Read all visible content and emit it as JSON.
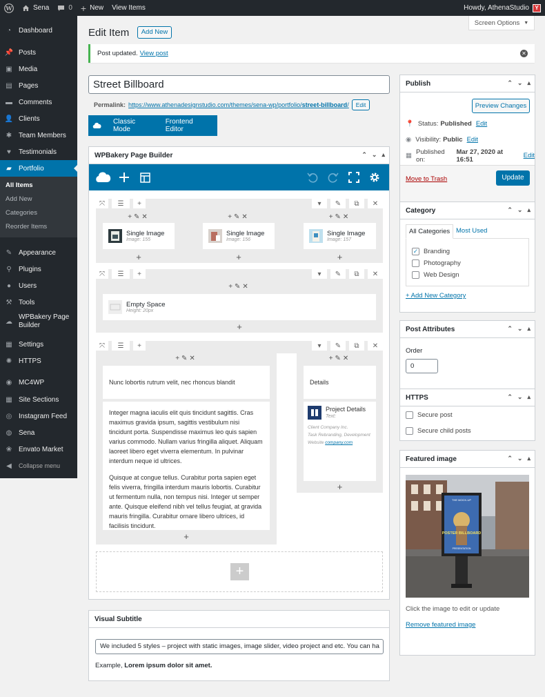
{
  "admin_bar": {
    "site_name": "Sena",
    "comments_count": "0",
    "new_label": "New",
    "view_items": "View Items",
    "howdy": "Howdy, AthenaStudio"
  },
  "sidebar": {
    "items": [
      {
        "label": "Dashboard",
        "icon": "dashboard-icon"
      },
      {
        "label": "Posts",
        "icon": "pin-icon"
      },
      {
        "label": "Media",
        "icon": "media-icon"
      },
      {
        "label": "Pages",
        "icon": "page-icon"
      },
      {
        "label": "Comments",
        "icon": "comment-icon"
      },
      {
        "label": "Clients",
        "icon": "clients-icon"
      },
      {
        "label": "Team Members",
        "icon": "star-icon"
      },
      {
        "label": "Testimonials",
        "icon": "heart-icon"
      },
      {
        "label": "Portfolio",
        "icon": "folder-icon"
      },
      {
        "label": "Appearance",
        "icon": "brush-icon"
      },
      {
        "label": "Plugins",
        "icon": "plugin-icon"
      },
      {
        "label": "Users",
        "icon": "user-icon"
      },
      {
        "label": "Tools",
        "icon": "wrench-icon"
      },
      {
        "label": "WPBakery Page Builder",
        "icon": "wpbakery-icon"
      },
      {
        "label": "Settings",
        "icon": "settings-icon"
      },
      {
        "label": "HTTPS",
        "icon": "gear-icon"
      },
      {
        "label": "MC4WP",
        "icon": "mc4wp-icon"
      },
      {
        "label": "Site Sections",
        "icon": "grid-icon"
      },
      {
        "label": "Instagram Feed",
        "icon": "instagram-icon"
      },
      {
        "label": "Sena",
        "icon": "sena-icon"
      },
      {
        "label": "Envato Market",
        "icon": "envato-icon"
      },
      {
        "label": "Collapse menu",
        "icon": "collapse-icon"
      }
    ],
    "portfolio_sub": [
      "All Items",
      "Add New",
      "Categories",
      "Reorder Items"
    ]
  },
  "header": {
    "title": "Edit Item",
    "add_new": "Add New",
    "screen_options": "Screen Options"
  },
  "notice": {
    "text": "Post updated.",
    "link": "View post"
  },
  "post": {
    "title": "Street Billboard",
    "permalink_label": "Permalink:",
    "permalink_base": "https://www.athenadesignstudio.com/themes/sena-wp/portfolio/",
    "permalink_slug": "street-billboard",
    "permalink_end": "/",
    "edit_label": "Edit"
  },
  "vc_bar": {
    "classic": "Classic Mode",
    "frontend": "Frontend Editor"
  },
  "wpb": {
    "title": "WPBakery Page Builder",
    "row1": [
      {
        "name": "Single Image",
        "sub": "Image: 155"
      },
      {
        "name": "Single Image",
        "sub": "Image: 156"
      },
      {
        "name": "Single Image",
        "sub": "Image: 157"
      }
    ],
    "row2": {
      "name": "Empty Space",
      "sub": "Height: 20px"
    },
    "row3": {
      "heading": "Nunc lobortis rutrum velit, nec rhoncus blandit",
      "para1": "Integer magna iaculis elit quis tincidunt sagittis. Cras maximus gravida ipsum, sagittis vestibulum nisi tincidunt porta. Suspendisse maximus leo quis sapien varius commodo. Nullam varius fringilla aliquet. Aliquam laoreet libero eget viverra elementum. In pulvinar interdum neque id ultrices.",
      "para2": "Quisque at congue tellus. Curabitur porta sapien eget felis viverra, fringilla interdum mauris lobortis. Curabitur ut fermentum nulla, non tempus nisi. Integer ut semper ante. Quisque eleifend nibh vel tellus feugiat, at gravida mauris fringilla. Curabitur ornare libero ultrices, id facilisis tincidunt.",
      "details_heading": "Details",
      "project_name": "Project Details",
      "project_text": "Text:",
      "client": "Client Company Inc.",
      "task": "Task Rebranding, Development",
      "website_label": "Website",
      "website_link": "company.com"
    }
  },
  "visual_subtitle": {
    "title": "Visual Subtitle",
    "value": "We included 5 styles – project with static images, image slider, video project and etc. You can ha",
    "example_prefix": "Example,",
    "example_bold": "Lorem ipsum dolor sit amet."
  },
  "publish": {
    "title": "Publish",
    "preview": "Preview Changes",
    "status_label": "Status:",
    "status_value": "Published",
    "visibility_label": "Visibility:",
    "visibility_value": "Public",
    "published_label": "Published on:",
    "published_value": "Mar 27, 2020 at 16:51",
    "edit": "Edit",
    "trash": "Move to Trash",
    "update": "Update"
  },
  "category": {
    "title": "Category",
    "tab_all": "All Categories",
    "tab_used": "Most Used",
    "items": [
      {
        "label": "Branding",
        "checked": true
      },
      {
        "label": "Photography",
        "checked": false
      },
      {
        "label": "Web Design",
        "checked": false
      }
    ],
    "add_new": "+ Add New Category"
  },
  "attributes": {
    "title": "Post Attributes",
    "order_label": "Order",
    "order_value": "0"
  },
  "https": {
    "title": "HTTPS",
    "secure_post": "Secure post",
    "secure_children": "Secure child posts"
  },
  "featured": {
    "title": "Featured image",
    "hint": "Click the image to edit or update",
    "remove": "Remove featured image",
    "poster_small": "THE MOCK-UP",
    "poster_big": "POSTER BILLBOARD",
    "poster_sub": "PRESENTATION"
  },
  "colors": {
    "accent": "#0073aa",
    "sidebar": "#23282d",
    "success": "#46b450",
    "trash": "#a00"
  }
}
